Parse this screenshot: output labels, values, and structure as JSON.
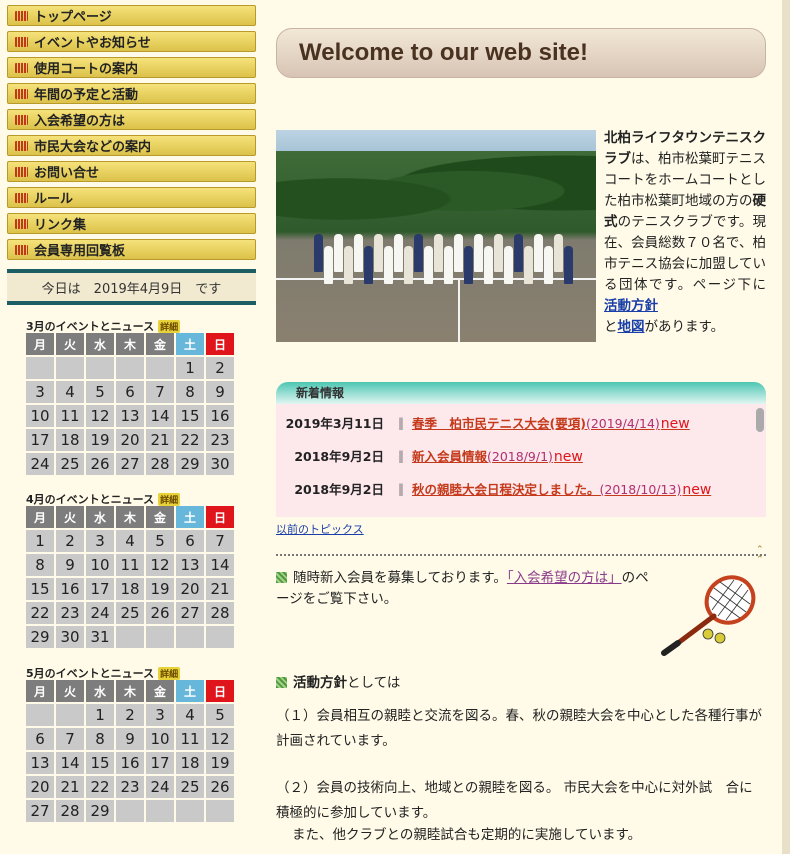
{
  "nav": [
    {
      "label": "トップページ"
    },
    {
      "label": "イベントやお知らせ"
    },
    {
      "label": "使用コートの案内"
    },
    {
      "label": "年間の予定と活動"
    },
    {
      "label": "入会希望の方は"
    },
    {
      "label": "市民大会などの案内"
    },
    {
      "label": "お問い合せ"
    },
    {
      "label": "ルール"
    },
    {
      "label": "リンク集"
    },
    {
      "label": "会員専用回覧板"
    }
  ],
  "today": "今日は　2019年4月9日　です",
  "calendars": [
    {
      "title": "3月のイベントとニュース",
      "detail": "詳細",
      "lead": 5,
      "days": 30
    },
    {
      "title": "4月のイベントとニュース",
      "detail": "詳細",
      "lead": 0,
      "days": 31
    },
    {
      "title": "5月のイベントとニュース",
      "detail": "詳細",
      "lead": 2,
      "days": 29
    }
  ],
  "weekdays": [
    "月",
    "火",
    "水",
    "木",
    "金",
    "土",
    "日"
  ],
  "welcome": "Welcome to our web site!",
  "intro": {
    "club_name": "北柏ライフタウンテニスクラブ",
    "text1": "は、柏市松葉町テニスコートをホームコートとした柏市松葉町地域の方の",
    "hard": "硬式",
    "text2": "のテニスクラブです。現在、会員総数７０名で、柏市テニス協会に加盟している団体です。ページ下に",
    "link_policy": "活動方針",
    "text3": "と",
    "link_map": "地図",
    "text4": "があります。"
  },
  "news": {
    "header": "新着情報",
    "items": [
      {
        "date": "2019年3月11日",
        "title": "春季　柏市民テニス大会(要項)",
        "extra": "(2019/4/14)",
        "badge": "new"
      },
      {
        "date": "2018年9月2日",
        "title": "新入会員情報",
        "extra": "(2018/9/1)",
        "badge": "new"
      },
      {
        "date": "2018年9月2日",
        "title": "秋の親睦大会日程決定しました。",
        "extra": "(2018/10/13)",
        "badge": "new"
      }
    ],
    "prev_link": "以前のトピックス"
  },
  "recruit": {
    "text1": "随時新入会員を募集しております。",
    "link": "「入会希望の方は」",
    "text2": "のページをご覧下さい。"
  },
  "policy": {
    "head_bold": "活動方針",
    "head_rest": "としては",
    "p1": "（１）会員相互の親睦と交流を図る。春、秋の親睦大会を中心とした各種行事が計画されています。",
    "p2": "（２）会員の技術向上、地域との親睦を図る。 市民大会を中心に対外試　合に積極的に参加しています。",
    "p3": "また、他クラブとの親睦試合も定期的に実施しています。"
  },
  "colors": {
    "nav_bg": "#e8cf57",
    "sat": "#67b7da",
    "sun": "#e0141b",
    "news_bg": "#fde8ec"
  }
}
